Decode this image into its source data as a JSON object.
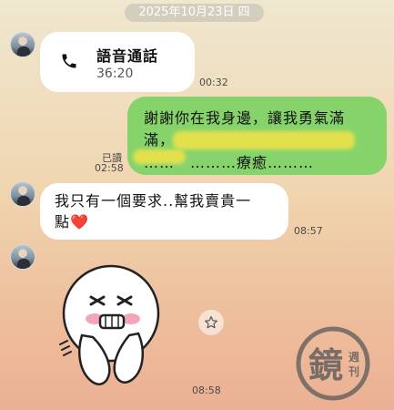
{
  "date_divider": "2025年10月23日 四",
  "call": {
    "title": "語音通話",
    "duration": "36:20",
    "time": "00:32",
    "icon": "phone-icon"
  },
  "sent_message": {
    "line1": "謝謝你在我身邊，讓我勇氣滿",
    "line2": "滿，",
    "line3": "……　………療癒………",
    "read_label": "已讀",
    "time": "02:58",
    "bubble_color": "#86d36c"
  },
  "received_message": {
    "line1": "我只有一個要求..幫我賣貴一",
    "line2": "點",
    "emoji": "❤️",
    "time": "08:57"
  },
  "sticker": {
    "time": "08:58"
  },
  "watermark": {
    "text": "鏡週刊"
  }
}
